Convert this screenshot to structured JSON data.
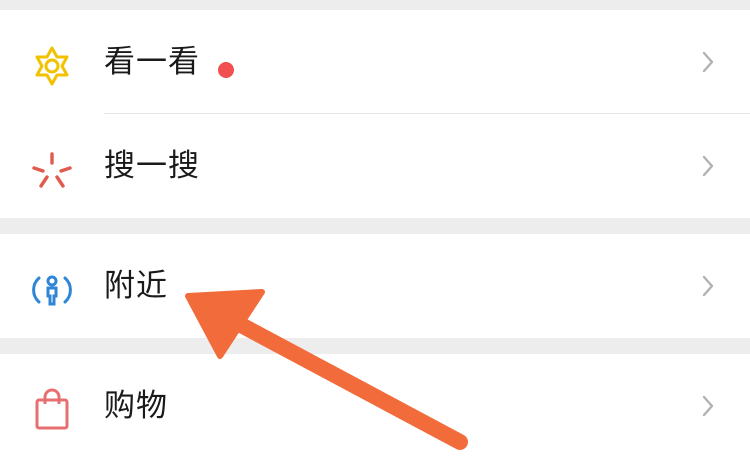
{
  "colors": {
    "background": "#ededed",
    "row_bg": "#ffffff",
    "text": "#1a1a1a",
    "chevron": "#b2b2b2",
    "badge_dot": "#f05050",
    "icon_look": "#f2c200",
    "icon_search": "#e05a4e",
    "icon_nearby": "#2f86d6",
    "icon_shopping": "#e86f6f",
    "arrow": "#f26b3a"
  },
  "discover": {
    "groups": [
      {
        "items": [
          {
            "label": "看一看",
            "icon": "star-flower-icon",
            "badge_dot": true
          },
          {
            "label": "搜一搜",
            "icon": "sparkle-burst-icon",
            "badge_dot": false
          }
        ]
      },
      {
        "items": [
          {
            "label": "附近",
            "icon": "nearby-person-icon",
            "badge_dot": false
          }
        ]
      },
      {
        "items": [
          {
            "label": "购物",
            "icon": "shopping-bag-icon",
            "badge_dot": false
          }
        ]
      }
    ]
  },
  "annotation": {
    "icon": "arrow-pointer-icon",
    "points_to": "附近"
  }
}
